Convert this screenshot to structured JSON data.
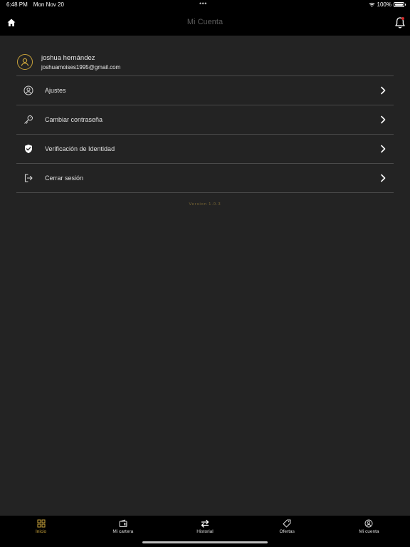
{
  "status_bar": {
    "time": "6:48 PM",
    "date": "Mon Nov 20",
    "dots": "•••",
    "battery_text": "100%",
    "battery_level": 1.0
  },
  "nav": {
    "title": "Mi Cuenta",
    "home_icon": "home-icon",
    "bell_icon": "bell-icon"
  },
  "profile": {
    "name": "joshua hernández",
    "email": "joshuamoises1995@gmail.com",
    "avatar_color": "#c8a23a"
  },
  "menu": {
    "items": [
      {
        "label": "Ajustes",
        "icon": "user-circle-icon"
      },
      {
        "label": "Cambiar contraseña",
        "icon": "key-icon"
      },
      {
        "label": "Verificación de Identidad",
        "icon": "shield-check-icon"
      },
      {
        "label": "Cerrar sesión",
        "icon": "logout-icon"
      }
    ]
  },
  "version": "Version 1.0.3",
  "tabs": [
    {
      "label": "Inicio",
      "icon": "grid-icon",
      "active": true
    },
    {
      "label": "Mi cartera",
      "icon": "wallet-icon",
      "active": false
    },
    {
      "label": "Historial",
      "icon": "swap-arrows-icon",
      "active": false
    },
    {
      "label": "Ofertas",
      "icon": "tag-icon",
      "active": false
    },
    {
      "label": "Mi cuenta",
      "icon": "user-circle-icon",
      "active": false
    }
  ],
  "colors": {
    "accent": "#c8a23a",
    "background": "#232323",
    "bar": "#000000",
    "notification": "#d12a2a"
  }
}
